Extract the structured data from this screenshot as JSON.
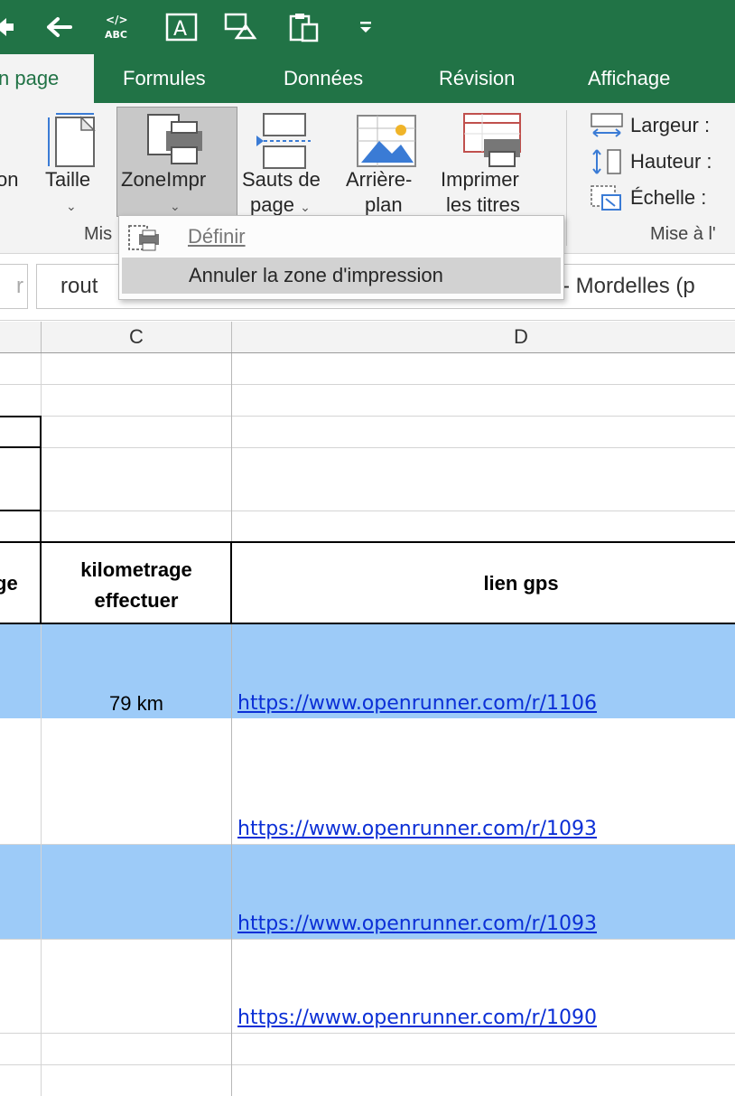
{
  "colors": {
    "excel_green": "#217346",
    "ribbon_bg": "#f3f3f3",
    "row_highlight": "#9dcbf8",
    "link": "#0b2fd6"
  },
  "qat": {
    "icons": [
      "save-forward-icon",
      "undo-icon",
      "spelling-abc-icon",
      "text-box-icon",
      "shapes-icon",
      "paste-clipboard-icon",
      "customize-qat-icon"
    ]
  },
  "tabs": [
    {
      "label": "n page",
      "active": true
    },
    {
      "label": "Formules"
    },
    {
      "label": "Données"
    },
    {
      "label": "Révision"
    },
    {
      "label": "Affichage"
    }
  ],
  "ribbon": {
    "orientation_partial": "on",
    "taille": "Taille",
    "zone_impr": "ZoneImpr",
    "sauts_line1": "Sauts de",
    "sauts_line2": "page",
    "arriere_line1": "Arrière-",
    "arriere_line2": "plan",
    "imprimer_line1": "Imprimer",
    "imprimer_line2": "les titres",
    "largeur": "Largeur :",
    "hauteur": "Hauteur :",
    "echelle": "Échelle :",
    "group_mise_partial": "Mis",
    "group_mise_right": "Mise à l'"
  },
  "dropdown": {
    "definir": "Définir",
    "annuler": "Annuler la zone d'impression"
  },
  "formula_bar": {
    "left_partial": "r",
    "name_box_partial": "rout",
    "content_partial": "- Mordelles (p"
  },
  "columns": {
    "c": "C",
    "d": "D"
  },
  "table": {
    "header_b_partial": "ge",
    "header_c_line1": "kilometrage",
    "header_c_line2": "effectuer",
    "header_d": "lien gps",
    "rows": [
      {
        "km": "79 km",
        "link": "https://www.openrunner.com/r/1106"
      },
      {
        "km": "",
        "link": "https://www.openrunner.com/r/1093"
      },
      {
        "km": "",
        "link": "https://www.openrunner.com/r/1093"
      },
      {
        "km": "",
        "link": "https://www.openrunner.com/r/1090"
      }
    ]
  }
}
